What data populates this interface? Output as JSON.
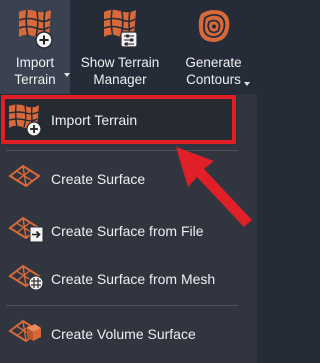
{
  "ribbon": {
    "import_terrain": {
      "line1": "Import",
      "line2": "Terrain",
      "icon": "terrain-import-icon"
    },
    "show_terrain_manager": {
      "line1": "Show Terrain",
      "line2": "Manager",
      "icon": "terrain-manager-icon"
    },
    "generate_contours": {
      "line1": "Generate",
      "line2": "Contours",
      "icon": "contours-icon"
    }
  },
  "menu": {
    "items": [
      {
        "label": "Import Terrain",
        "icon": "terrain-import-icon"
      },
      {
        "label": "Create Surface",
        "icon": "surface-icon"
      },
      {
        "label": "Create Surface from File",
        "icon": "surface-from-file-icon"
      },
      {
        "label": "Create Surface from Mesh",
        "icon": "surface-from-mesh-icon"
      },
      {
        "label": "Create Volume Surface",
        "icon": "volume-surface-icon"
      }
    ]
  },
  "colors": {
    "background": "#262c37",
    "menu_background": "#30353f",
    "highlight_border": "#e11f26",
    "terrain_orange": "#d8693a"
  }
}
